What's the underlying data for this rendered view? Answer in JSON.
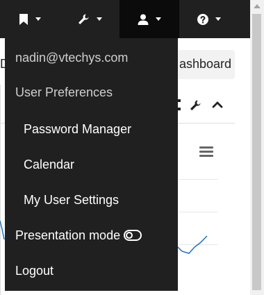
{
  "navbar": {
    "items": [
      {
        "name": "bookmark-icon"
      },
      {
        "name": "wrench-icon"
      },
      {
        "name": "user-icon"
      },
      {
        "name": "help-icon"
      }
    ]
  },
  "background": {
    "left_fragment": "D",
    "breadcrumb_fragment": "ashboard"
  },
  "dropdown": {
    "email": "nadin@vtechys.com",
    "section_header": "User Preferences",
    "password_manager": "Password Manager",
    "calendar": "Calendar",
    "my_user_settings": "My User Settings",
    "presentation_mode": "Presentation mode",
    "logout": "Logout"
  },
  "colors": {
    "navbar_bg": "#202020",
    "navbar_active": "#0b0b0b",
    "dropdown_bg": "#202020",
    "chart_line": "#1f6fbf"
  }
}
